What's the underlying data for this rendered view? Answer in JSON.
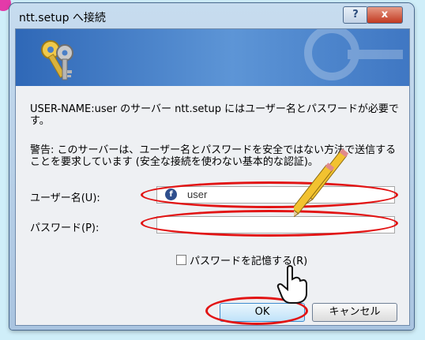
{
  "window": {
    "title": "ntt.setup へ接続",
    "help_label": "?",
    "close_label": "x"
  },
  "message": "USER-NAME:user のサーバー ntt.setup にはユーザー名とパスワードが必要です。",
  "warning": "警告: このサーバーは、ユーザー名とパスワードを安全ではない方法で送信することを要求しています (安全な接続を使わない基本的な認証)。",
  "form": {
    "username_label": "ユーザー名(U):",
    "username_value": "user",
    "username_icon": "user-icon",
    "password_label": "パスワード(P):",
    "password_value": "",
    "remember_label": "パスワードを記憶する(R)"
  },
  "buttons": {
    "ok": "OK",
    "cancel": "キャンセル"
  },
  "colors": {
    "annotation_red": "#e21414",
    "banner_blue": "#2f68b7",
    "pencil_yellow": "#f2c230"
  },
  "annotations": [
    "red-ellipse-annotation",
    "pencil-annotation",
    "pointing-hand-cursor-icon"
  ]
}
